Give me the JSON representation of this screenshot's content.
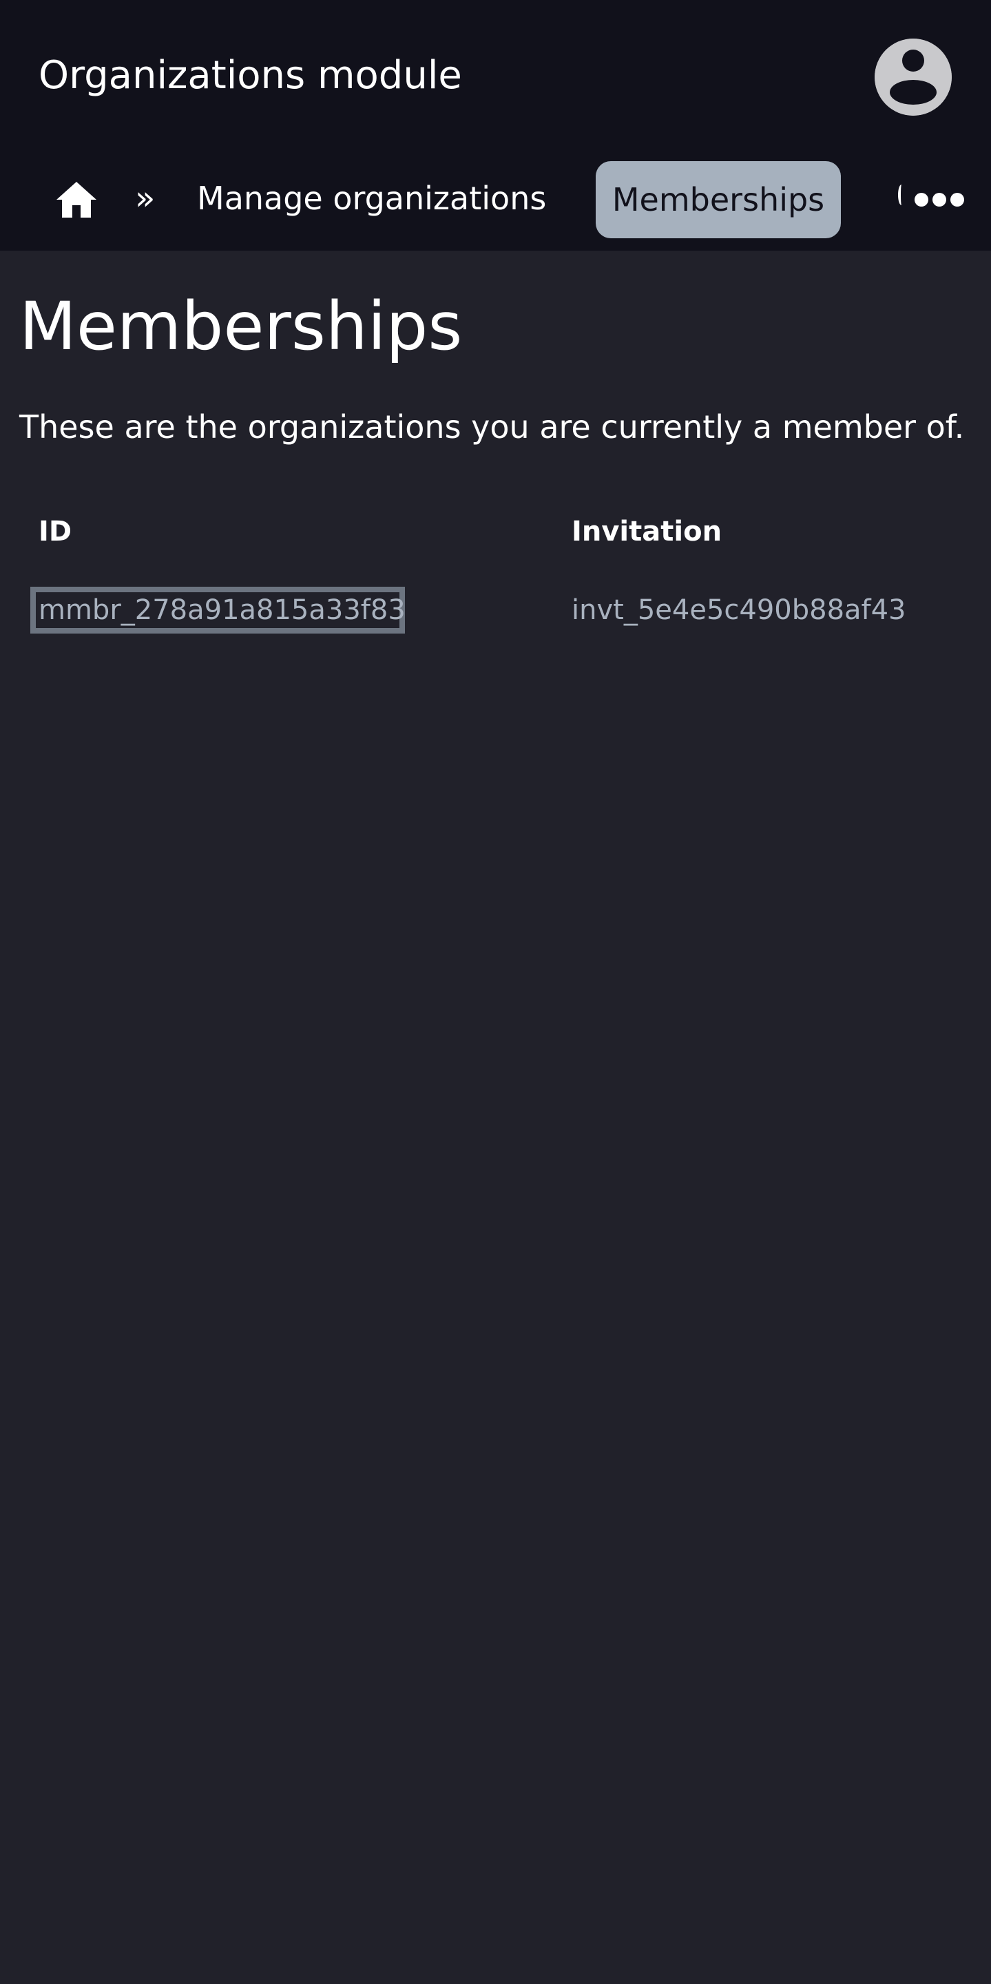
{
  "header": {
    "title": "Organizations module",
    "avatar_icon": "user-avatar-icon"
  },
  "breadcrumb": {
    "home_icon": "home-icon",
    "separator": "»",
    "items": [
      {
        "label": "Manage organizations"
      },
      {
        "label": "Memberships",
        "current": true
      }
    ],
    "more_icon": "more-horizontal-icon"
  },
  "main": {
    "title": "Memberships",
    "description": "These are the organizations you are currently a member of.",
    "table": {
      "columns": [
        "ID",
        "Invitation"
      ],
      "rows": [
        {
          "id": "mmbr_278a91a815a33f83",
          "invitation": "invt_5e4e5c490b88af43"
        }
      ]
    }
  },
  "colors": {
    "header_bg": "#11111b",
    "page_bg": "#21212a",
    "active_crumb_bg": "#a6b1be",
    "muted_text": "#a9b2bf",
    "focus_outline": "#6c7480"
  }
}
